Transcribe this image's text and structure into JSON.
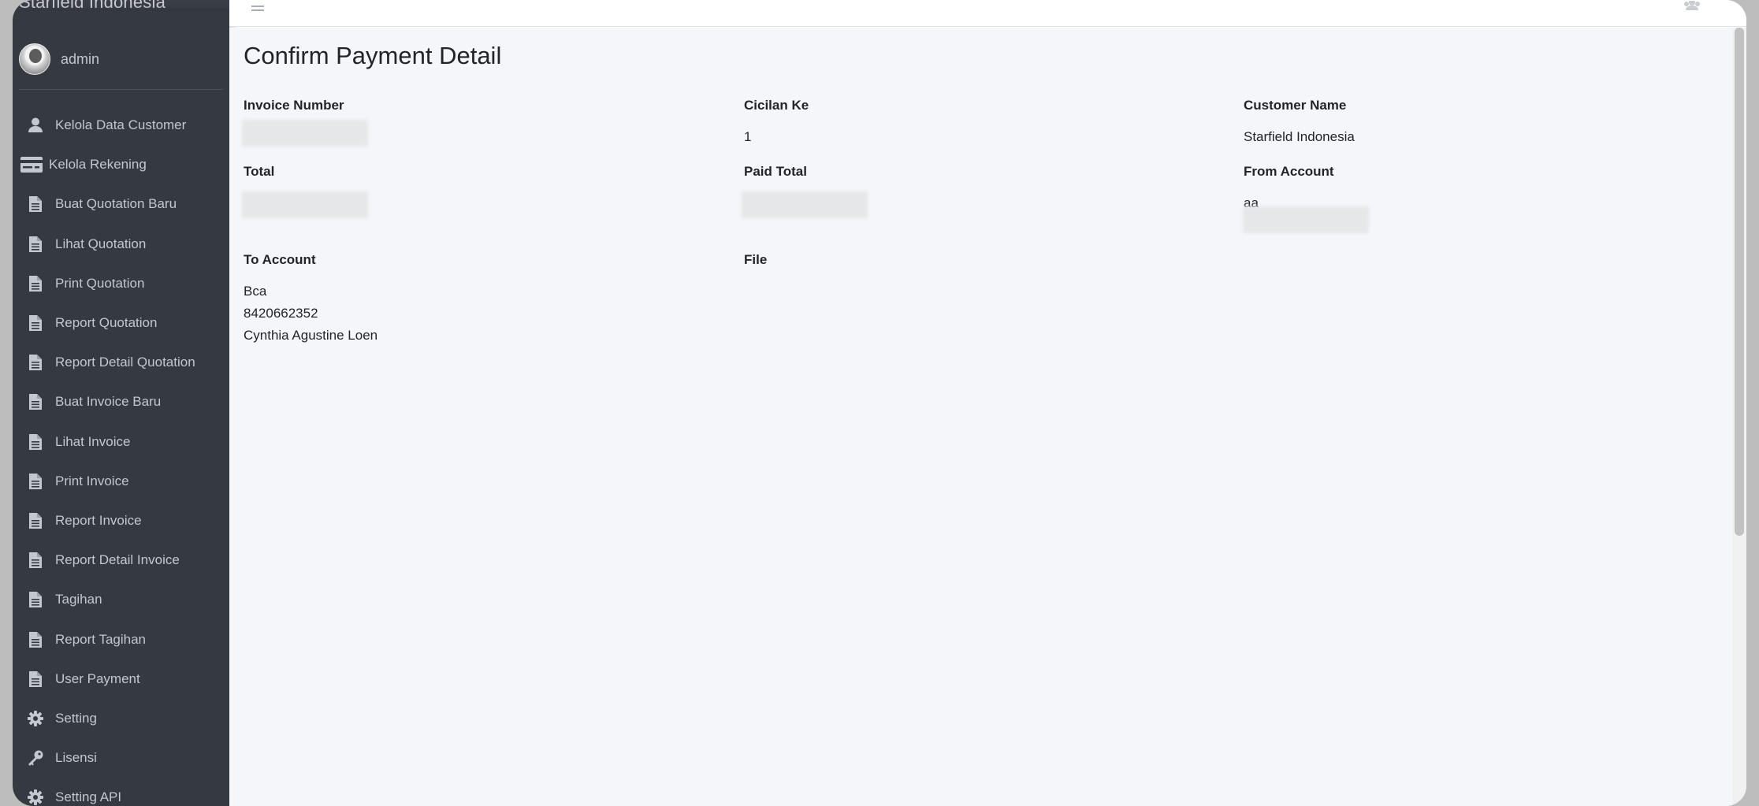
{
  "brand": {
    "title": "Starfield Indonesia"
  },
  "user": {
    "name": "admin"
  },
  "sidebar": {
    "items": [
      {
        "label": "Kelola Data Customer",
        "icon": "user-icon"
      },
      {
        "label": "Kelola Rekening",
        "icon": "credit-card-icon"
      },
      {
        "label": "Buat Quotation Baru",
        "icon": "file-icon"
      },
      {
        "label": "Lihat Quotation",
        "icon": "file-icon"
      },
      {
        "label": "Print Quotation",
        "icon": "file-icon"
      },
      {
        "label": "Report Quotation",
        "icon": "file-icon"
      },
      {
        "label": "Report Detail Quotation",
        "icon": "file-icon"
      },
      {
        "label": "Buat Invoice Baru",
        "icon": "file-icon"
      },
      {
        "label": "Lihat Invoice",
        "icon": "file-icon"
      },
      {
        "label": "Print Invoice",
        "icon": "file-icon"
      },
      {
        "label": "Report Invoice",
        "icon": "file-icon"
      },
      {
        "label": "Report Detail Invoice",
        "icon": "file-icon"
      },
      {
        "label": "Tagihan",
        "icon": "file-icon"
      },
      {
        "label": "Report Tagihan",
        "icon": "file-icon"
      },
      {
        "label": "User Payment",
        "icon": "file-icon"
      },
      {
        "label": "Setting",
        "icon": "gear-icon"
      },
      {
        "label": "Lisensi",
        "icon": "key-icon"
      },
      {
        "label": "Setting API",
        "icon": "gear-icon"
      }
    ]
  },
  "topbar": {
    "menu_icon": "hamburger-icon",
    "user_icon": "users-icon"
  },
  "page": {
    "title": "Confirm Payment Detail",
    "fields": {
      "invoice_number": {
        "label": "Invoice Number"
      },
      "cicilan_ke": {
        "label": "Cicilan Ke",
        "value": "1"
      },
      "customer_name": {
        "label": "Customer Name",
        "value": "Starfield Indonesia"
      },
      "total": {
        "label": "Total"
      },
      "paid_total": {
        "label": "Paid Total"
      },
      "from_account": {
        "label": "From Account",
        "value": "aa"
      },
      "to_account": {
        "label": "To Account",
        "bank": "Bca",
        "number": "8420662352",
        "holder": "Cynthia Agustine Loen"
      },
      "file": {
        "label": "File"
      }
    }
  },
  "colors": {
    "sidebar_bg": "#343a40",
    "sidebar_text": "#c2c7d0",
    "content_bg": "#f4f6f9"
  }
}
